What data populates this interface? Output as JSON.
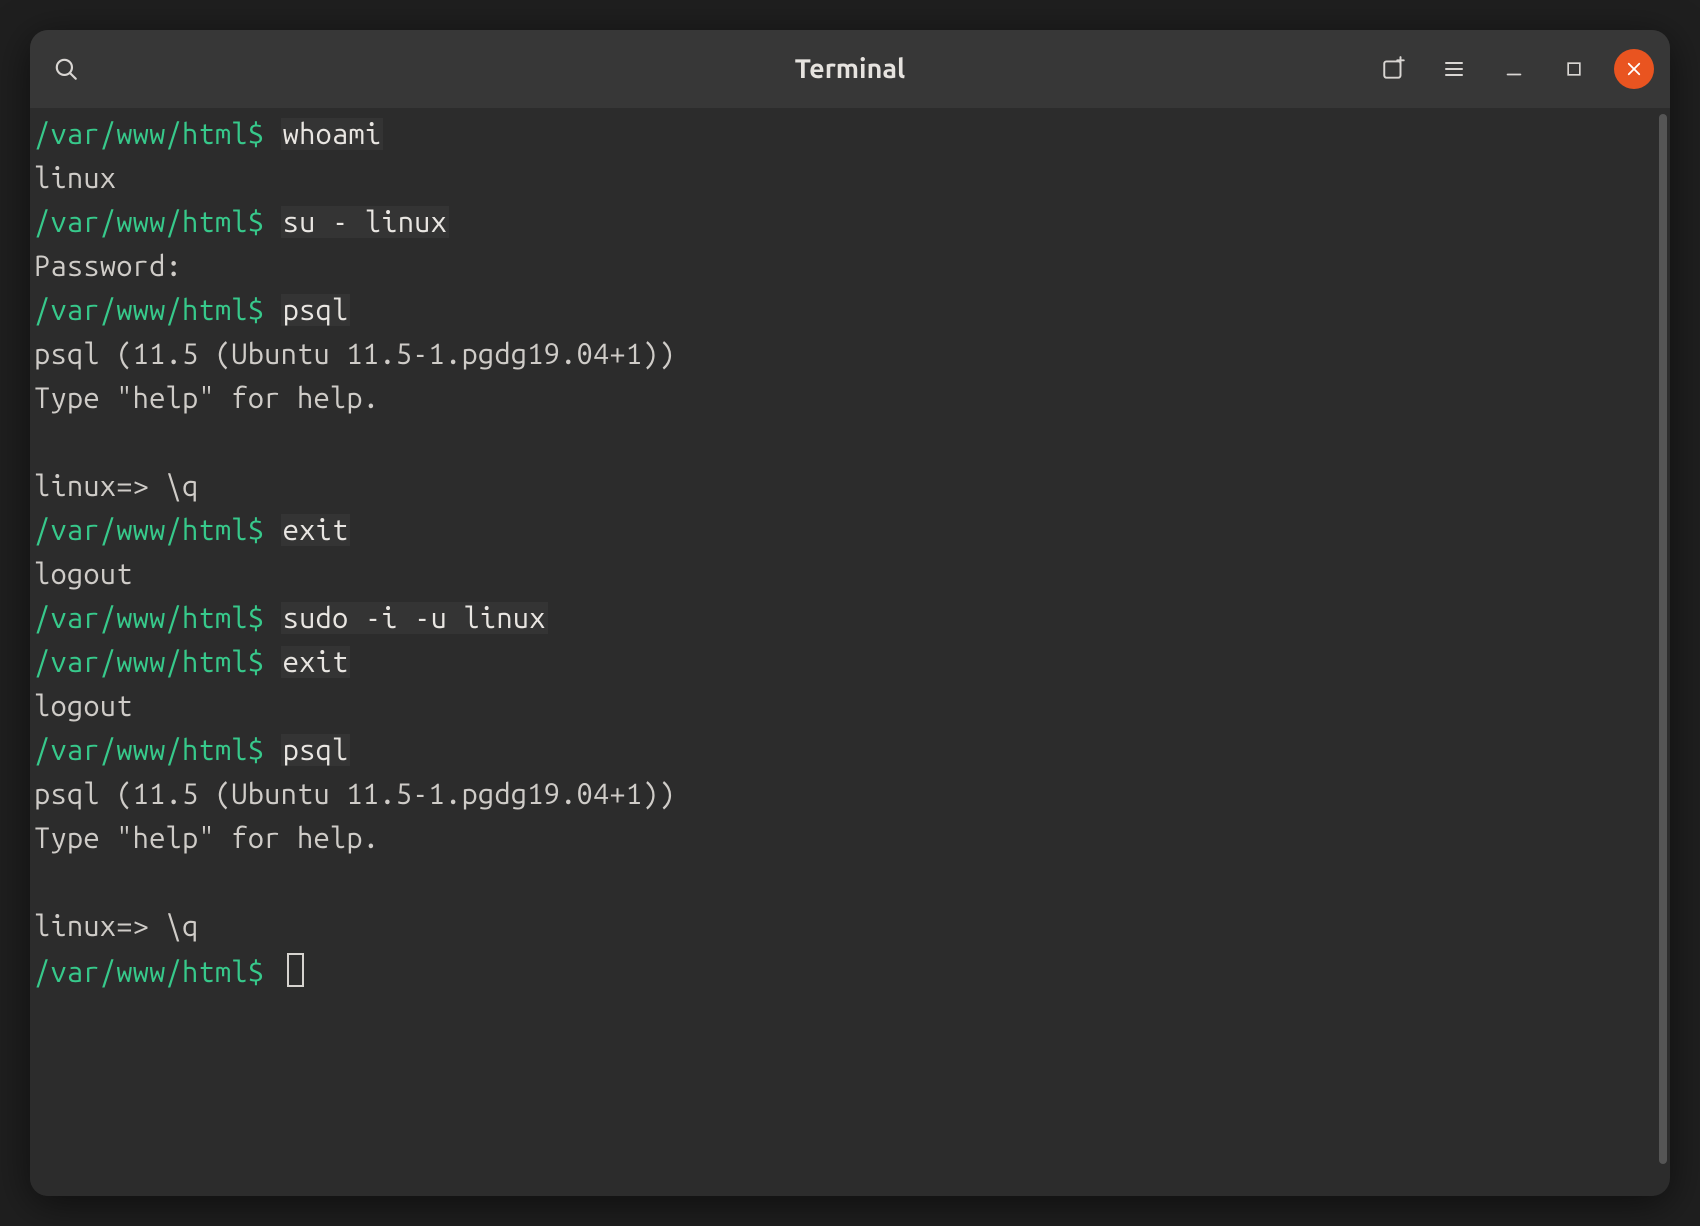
{
  "window": {
    "title": "Terminal"
  },
  "colors": {
    "prompt": "#37c98b",
    "text": "#cfccc8",
    "close": "#e95420",
    "bg": "#2c2c2c"
  },
  "lines": [
    {
      "kind": "prompt",
      "path": "/var/www/html",
      "sym": "$",
      "cmd": "whoami",
      "cmd_hl": true
    },
    {
      "kind": "out",
      "text": "linux"
    },
    {
      "kind": "prompt",
      "path": "/var/www/html",
      "sym": "$",
      "cmd": "su - linux",
      "cmd_hl": true
    },
    {
      "kind": "out",
      "text": "Password: "
    },
    {
      "kind": "prompt",
      "path": "/var/www/html",
      "sym": "$",
      "cmd": "psql",
      "cmd_hl": true
    },
    {
      "kind": "out",
      "text": "psql (11.5 (Ubuntu 11.5-1.pgdg19.04+1))"
    },
    {
      "kind": "out",
      "text": "Type \"help\" for help."
    },
    {
      "kind": "out",
      "text": ""
    },
    {
      "kind": "out",
      "text": "linux=> \\q"
    },
    {
      "kind": "prompt",
      "path": "/var/www/html",
      "sym": "$",
      "cmd": "exit",
      "cmd_hl": true
    },
    {
      "kind": "out",
      "text": "logout"
    },
    {
      "kind": "prompt",
      "path": "/var/www/html",
      "sym": "$",
      "cmd": "sudo -i -u linux",
      "cmd_hl": true
    },
    {
      "kind": "prompt",
      "path": "/var/www/html",
      "sym": "$",
      "cmd": "exit",
      "cmd_hl": true
    },
    {
      "kind": "out",
      "text": "logout"
    },
    {
      "kind": "prompt",
      "path": "/var/www/html",
      "sym": "$",
      "cmd": "psql",
      "cmd_hl": true
    },
    {
      "kind": "out",
      "text": "psql (11.5 (Ubuntu 11.5-1.pgdg19.04+1))"
    },
    {
      "kind": "out",
      "text": "Type \"help\" for help."
    },
    {
      "kind": "out",
      "text": ""
    },
    {
      "kind": "out",
      "text": "linux=> \\q"
    },
    {
      "kind": "prompt",
      "path": "/var/www/html",
      "sym": "$",
      "cmd": "",
      "cmd_hl": false,
      "cursor": true
    }
  ]
}
